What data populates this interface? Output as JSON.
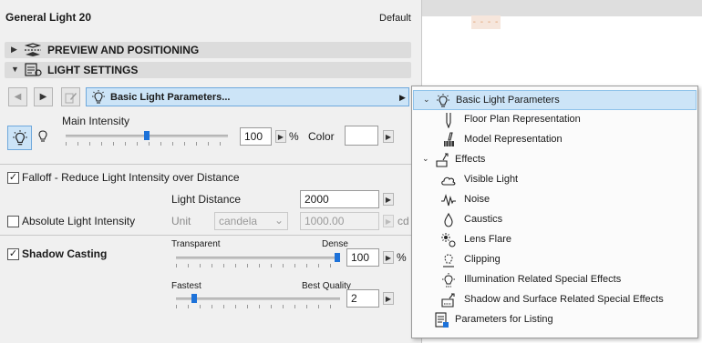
{
  "panel": {
    "title": "General Light 20",
    "default_label": "Default"
  },
  "sections": {
    "preview": "PREVIEW AND POSITIONING",
    "light_settings": "LIGHT SETTINGS"
  },
  "toolbar": {
    "page_selector": "Basic Light Parameters..."
  },
  "main_intensity": {
    "label": "Main Intensity",
    "value": "100",
    "unit": "%",
    "level": 0.5,
    "color_label": "Color"
  },
  "falloff": {
    "checked": true,
    "label": "Falloff - Reduce Light Intensity over Distance",
    "distance_label": "Light Distance",
    "distance_value": "2000"
  },
  "absolute": {
    "checked": false,
    "label": "Absolute Light Intensity",
    "unit_label": "Unit",
    "unit_select": "candela",
    "value": "1000.00",
    "value_unit": "cd"
  },
  "shadow": {
    "checked": true,
    "label": "Shadow Casting",
    "transparent_label": "Transparent",
    "dense_label": "Dense",
    "density_value": "100",
    "density_unit": "%",
    "density_level": 1.0,
    "fastest_label": "Fastest",
    "best_label": "Best Quality",
    "quality_value": "2",
    "quality_level": 0.1
  },
  "menu": {
    "items": [
      {
        "label": "Basic Light Parameters",
        "icon": "bulb-icon"
      },
      {
        "label": "Floor Plan Representation",
        "icon": "floor-plan-icon"
      },
      {
        "label": "Model Representation",
        "icon": "brush-icon"
      },
      {
        "label": "Effects",
        "icon": "effects-icon"
      },
      {
        "label": "Visible Light",
        "icon": "cloud-icon"
      },
      {
        "label": "Noise",
        "icon": "noise-icon"
      },
      {
        "label": "Caustics",
        "icon": "drop-icon"
      },
      {
        "label": "Lens Flare",
        "icon": "lens-flare-icon"
      },
      {
        "label": "Clipping",
        "icon": "clipping-icon"
      },
      {
        "label": "Illumination Related Special Effects",
        "icon": "illumination-icon"
      },
      {
        "label": "Shadow and Surface Related Special Effects",
        "icon": "shadow-surface-icon"
      },
      {
        "label": "Parameters for Listing",
        "icon": "listing-icon"
      }
    ]
  },
  "colors": {
    "accent": "#1d72d9",
    "selection": "#cce4f7",
    "panel": "#f0f0f0"
  }
}
